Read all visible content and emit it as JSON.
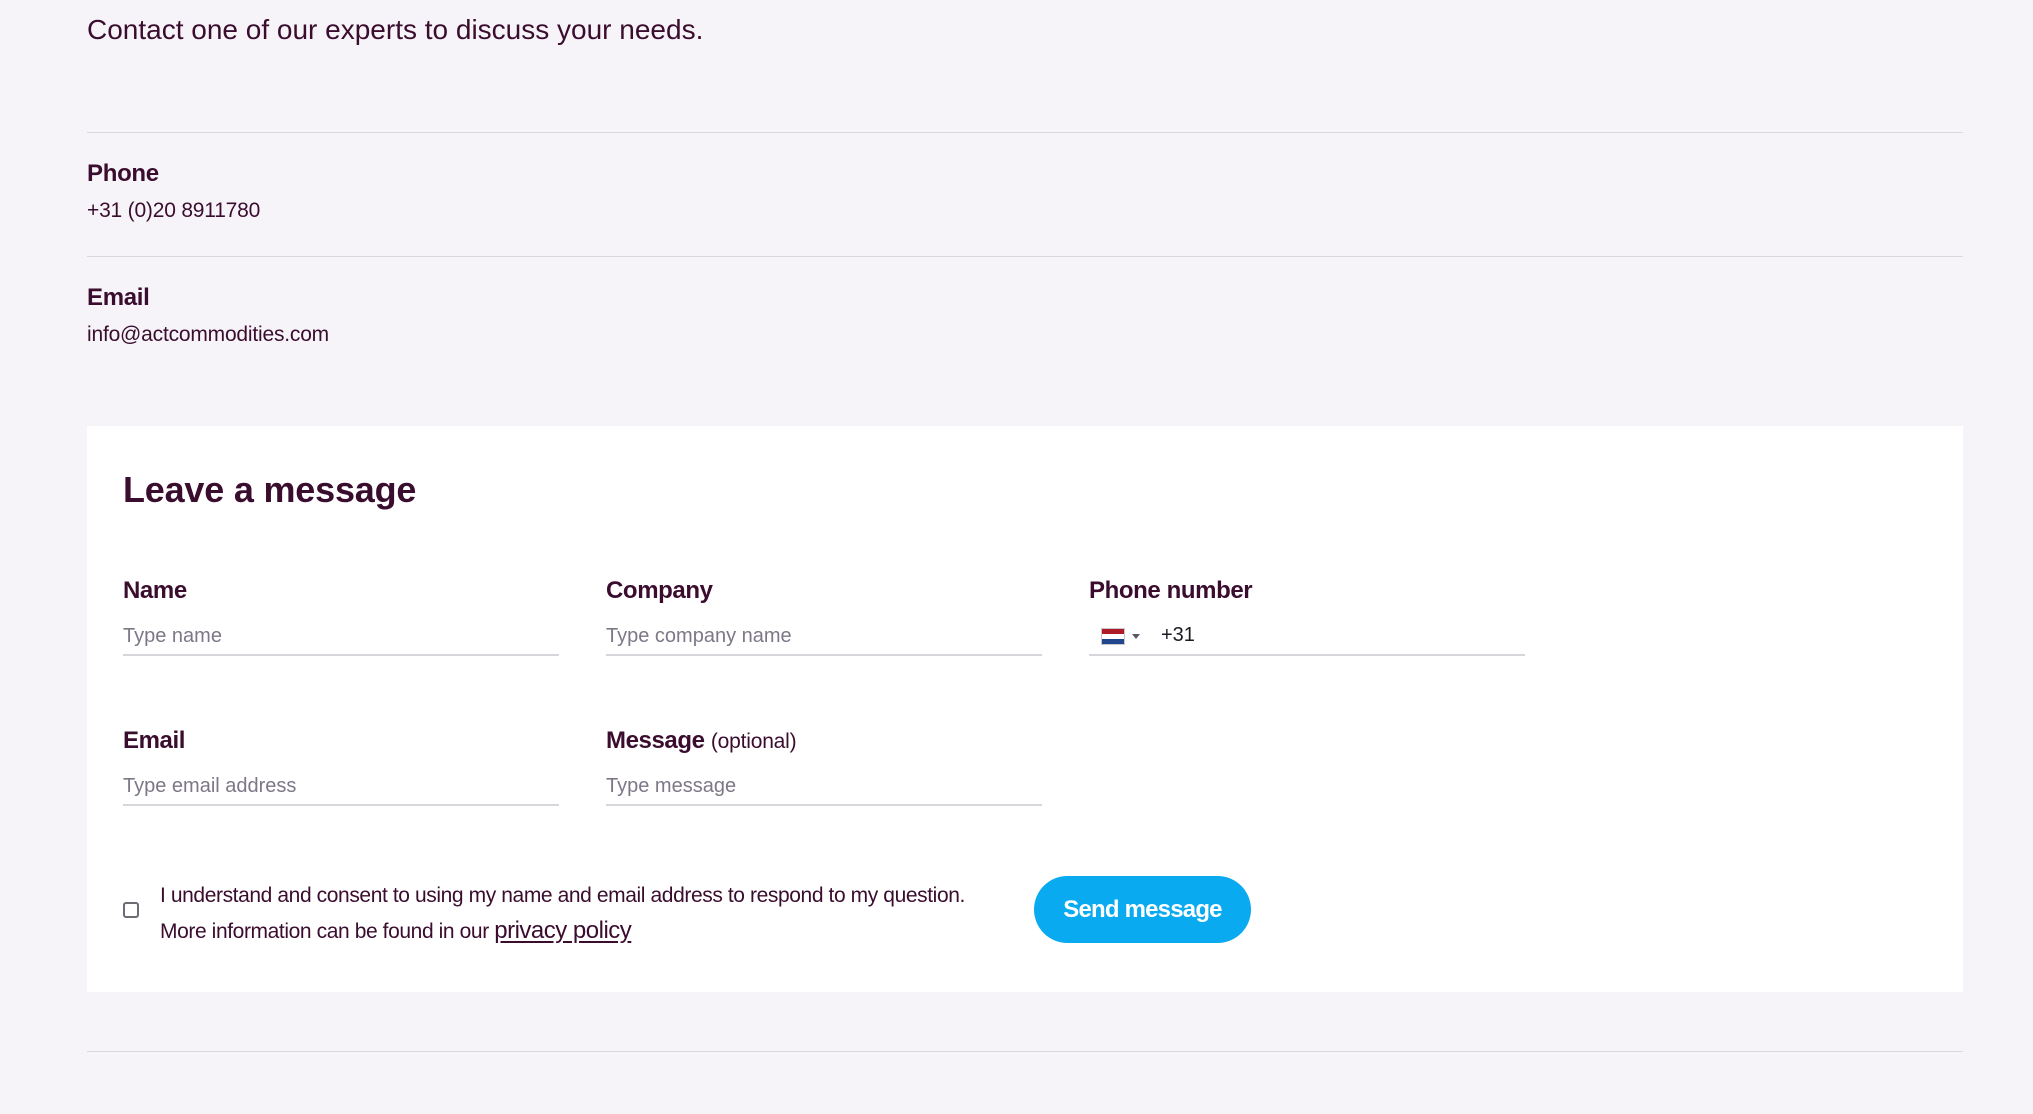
{
  "intro": {
    "text": "Contact one of our experts to discuss your needs."
  },
  "contact": {
    "phone": {
      "label": "Phone",
      "value": "+31 (0)20 8911780"
    },
    "email": {
      "label": "Email",
      "value": "info@actcommodities.com"
    }
  },
  "form": {
    "title": "Leave a message",
    "name": {
      "label": "Name",
      "placeholder": "Type name"
    },
    "company": {
      "label": "Company",
      "placeholder": "Type company name"
    },
    "phone": {
      "label": "Phone number",
      "country_code": "+31",
      "flag_icon": "netherlands-flag-icon"
    },
    "email": {
      "label": "Email",
      "placeholder": "Type email address"
    },
    "message": {
      "label": "Message",
      "optional": "(optional)",
      "placeholder": "Type message"
    },
    "consent": {
      "line1": "I understand and consent to using my name and email address to respond to my question.",
      "line2_prefix": "More information can be found in our ",
      "link": "privacy policy"
    },
    "submit_label": "Send message"
  },
  "colors": {
    "page_bg": "#f6f4f9",
    "text": "#3a0d2e",
    "accent": "#0aaaf0",
    "card_bg": "#ffffff"
  }
}
